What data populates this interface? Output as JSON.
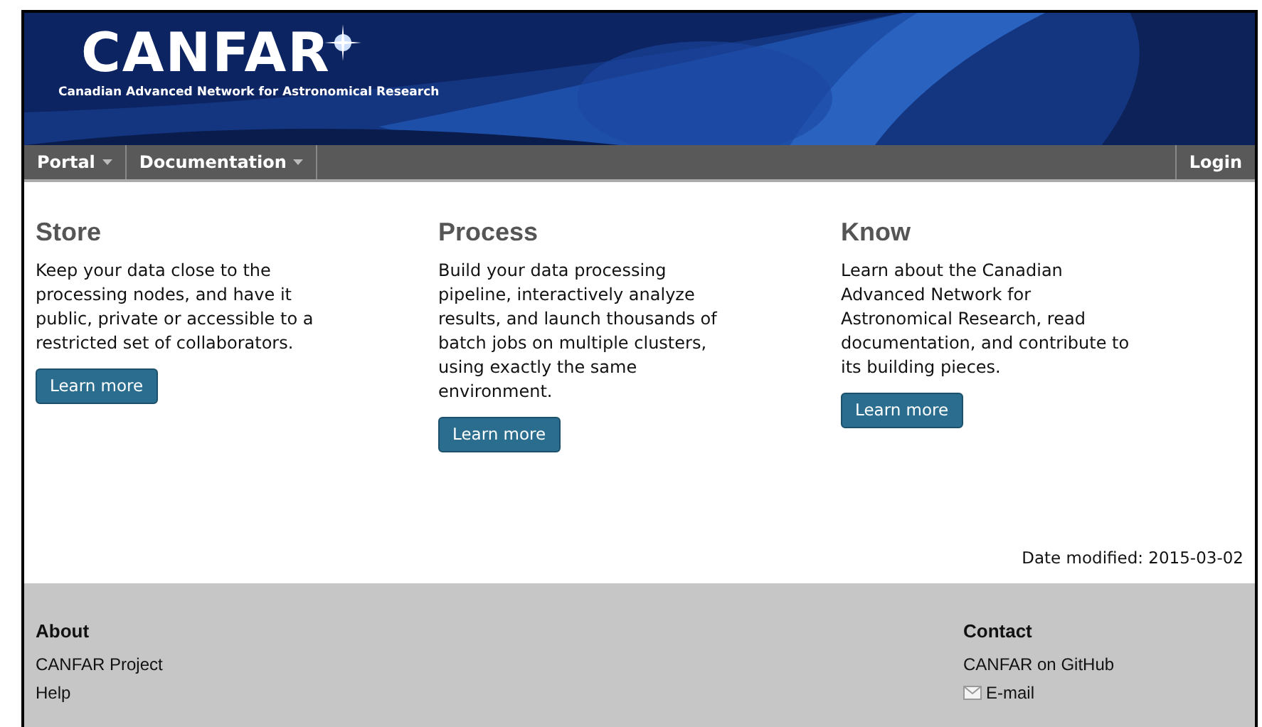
{
  "banner": {
    "logo": "CANFAR",
    "subtitle": "Canadian Advanced Network for Astronomical Research"
  },
  "nav": {
    "menus": [
      {
        "label": "Portal",
        "dropdown": true
      },
      {
        "label": "Documentation",
        "dropdown": true
      }
    ],
    "login": "Login"
  },
  "columns": [
    {
      "title": "Store",
      "text": "Keep your data close to the processing nodes, and have it public, private or accessible to a restricted set of collaborators.",
      "button": "Learn more"
    },
    {
      "title": "Process",
      "text": "Build your data processing pipeline, interactively analyze results, and launch thousands of batch jobs on multiple clusters, using exactly the same environment.",
      "button": "Learn more"
    },
    {
      "title": "Know",
      "text": "Learn about the Canadian Advanced Network for Astronomical Research, read documentation, and contribute to its building pieces.",
      "button": "Learn more"
    }
  ],
  "date_modified": "Date modified: 2015-03-02",
  "footer": {
    "sections": [
      {
        "title": "About",
        "links": [
          {
            "label": "CANFAR Project"
          },
          {
            "label": "Help"
          }
        ]
      },
      {
        "title": "Contact",
        "links": [
          {
            "label": "CANFAR on GitHub"
          },
          {
            "label": "E-mail",
            "kind": "mail"
          }
        ]
      }
    ]
  }
}
